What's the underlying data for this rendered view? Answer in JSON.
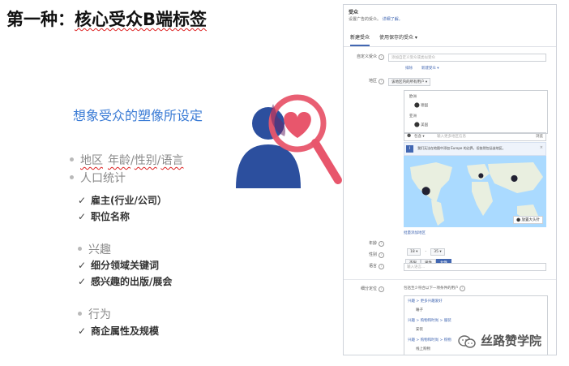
{
  "slide": {
    "title_prefix": "第一种：",
    "title_underlined": "核心受众B端标签",
    "subtitle": "想象受众的塑像所设定",
    "bullet1": {
      "a": "地区",
      "b": "年龄",
      "slash1": "/",
      "c": "性别",
      "slash2": "/",
      "d": "语言"
    },
    "bullet2": "人口统计",
    "bullet2_items": [
      "雇主(行业/公司）",
      "职位名称"
    ],
    "bullet3": "兴趣",
    "bullet3_items": [
      "细分领域关键词",
      "感兴趣的出版/展会"
    ],
    "bullet4": "行为",
    "bullet4_items": [
      "商企属性及规模"
    ],
    "check": "✓"
  },
  "illustration": {
    "person_color": "#2c4f9e",
    "heart_color": "#e8566c",
    "magnifier_color": "#e8566c",
    "icons": [
      "user-icon",
      "heart-icon",
      "magnifier-icon"
    ]
  },
  "panel": {
    "title": "受众",
    "desc": "设置广告的受众。",
    "desc_link": "详细了解。",
    "tab_new": "新建受众",
    "tab_saved": "使用保存的受众 ▾",
    "custom_audience_label": "自定义受众",
    "custom_audience_placeholder": "添加自定义受众或类似受众",
    "exclude": "排除",
    "new_audience": "新建受众 ▾",
    "location_label": "地区",
    "location_dd": "该地区内的所有用户 ▾",
    "country1_region": "欧洲",
    "country1": "德国",
    "country2_region": "亚洲",
    "country2": "美国",
    "include_dd": "包含 ▾",
    "location_search_placeholder": "输入更多地区信息",
    "browse": "浏览",
    "map_notice": "我们无法在地图中添加 Europe 的边界，但依然包括该地区。",
    "drop_pin": "放置大头针",
    "bulk_add": "批量添加地区",
    "age_label": "年龄",
    "age_from": "18 ▾",
    "age_dash": "-",
    "age_to": "35 ▾",
    "gender_label": "性别",
    "gender_all": "不限",
    "gender_male": "男性",
    "gender_female": "女性",
    "language_label": "语言",
    "language_placeholder": "输入语言...",
    "detailed_label": "细分定位",
    "detailed_desc": "包括至少符合以下一项条件的用户",
    "cat1": "兴趣 > 更多兴趣爱好",
    "cat1_item": "睡子",
    "cat2": "兴趣 > 购物和时尚 > 服装",
    "cat2_item": "安装",
    "cat3": "兴趣 > 购物和时尚 > 购物",
    "cat3_item": "线上购物"
  },
  "watermark": "丝路赞学院"
}
